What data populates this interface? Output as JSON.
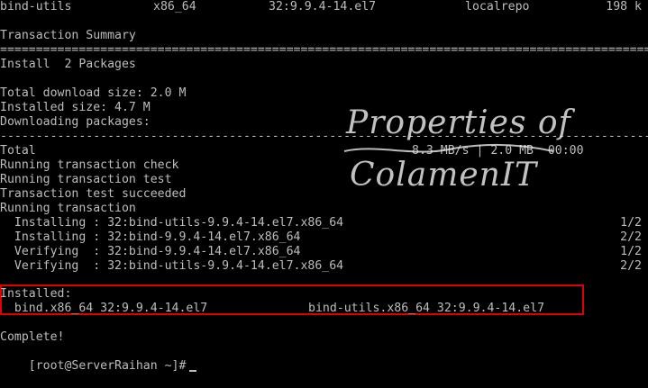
{
  "package_row": {
    "name": "bind-utils",
    "arch": "x86_64",
    "version": "32:9.9.4-14.el7",
    "repo": "localrepo",
    "size": "198 k"
  },
  "summary": {
    "title": "Transaction Summary",
    "separator": "================================================================================================",
    "install_label": "Install  2 Packages"
  },
  "download": {
    "total_download": "Total download size: 2.0 M",
    "installed_size": "Installed size: 4.7 M",
    "downloading": "Downloading packages:",
    "dash_separator": "------------------------------------------------------------------------------------------------",
    "total_label": "Total",
    "total_rate": "8.3 MB/s | 2.0 MB  00:00"
  },
  "transaction": {
    "check": "Running transaction check",
    "test": "Running transaction test",
    "test_ok": "Transaction test succeeded",
    "running": "Running transaction",
    "steps": [
      {
        "text": "  Installing : 32:bind-utils-9.9.4-14.el7.x86_64",
        "count": "1/2"
      },
      {
        "text": "  Installing : 32:bind-9.9.4-14.el7.x86_64",
        "count": "2/2"
      },
      {
        "text": "  Verifying  : 32:bind-9.9.4-14.el7.x86_64",
        "count": "1/2"
      },
      {
        "text": "  Verifying  : 32:bind-utils-9.9.4-14.el7.x86_64",
        "count": "2/2"
      }
    ]
  },
  "installed": {
    "label": "Installed:",
    "pkg1": "  bind.x86_64 32:9.9.4-14.el7",
    "pkg2": "bind-utils.x86_64 32:9.9.4-14.el7"
  },
  "footer": {
    "complete": "Complete!",
    "prompt": "[root@ServerRaihan ~]#"
  },
  "watermark": {
    "line1": "Properties of",
    "line2": "ColamenIT"
  },
  "colors": {
    "background": "#000000",
    "text": "#bdbdbd",
    "highlight_border": "#e00000"
  }
}
